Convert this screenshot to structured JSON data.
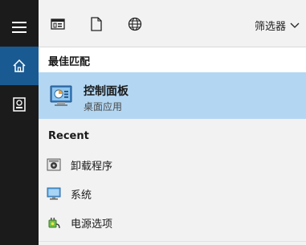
{
  "rail": {
    "items": [
      {
        "icon": "hamburger-menu-icon"
      },
      {
        "icon": "home-icon",
        "active": true
      },
      {
        "icon": "document-reader-icon"
      }
    ]
  },
  "toolbar": {
    "icons": [
      "app-window-icon",
      "document-icon",
      "globe-icon"
    ],
    "filter_label": "筛选器"
  },
  "best_match": {
    "section_label": "最佳匹配",
    "title": "控制面板",
    "subtitle": "桌面应用",
    "icon": "control-panel-icon"
  },
  "recent": {
    "section_label": "Recent",
    "items": [
      {
        "label": "卸载程序",
        "icon": "uninstall-program-icon"
      },
      {
        "label": "系统",
        "icon": "system-monitor-icon"
      },
      {
        "label": "电源选项",
        "icon": "power-options-icon"
      }
    ]
  },
  "colors": {
    "rail_bg": "#1b1b1b",
    "rail_active": "#1a5a92",
    "highlight": "#b3d7f3",
    "panel_bg": "#f2f2f2"
  }
}
